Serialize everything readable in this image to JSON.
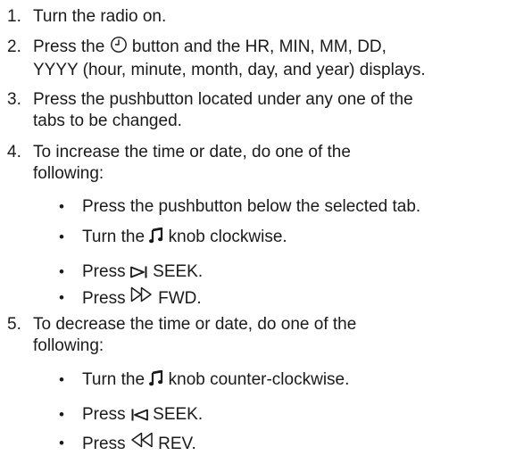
{
  "steps": [
    {
      "n": "1.",
      "lines": [
        "Turn the radio on."
      ]
    },
    {
      "n": "2.",
      "l1a": "Press the",
      "l1b": "button and the HR, MIN, MM, DD,",
      "l2": "YYYY (hour, minute, month, day, and year) displays.",
      "icon": "clock-icon"
    },
    {
      "n": "3.",
      "lines": [
        "Press the pushbutton located under any one of the",
        "tabs to be changed."
      ]
    },
    {
      "n": "4.",
      "lines": [
        "To increase the time or date, do one of the",
        "following:"
      ],
      "bullets": [
        {
          "text": "Press the pushbutton below the selected tab."
        },
        {
          "pre": "Turn the",
          "post": "knob clockwise.",
          "icon": "music-note-icon"
        },
        {
          "pre": "Press",
          "post": "SEEK.",
          "icon": "seek-forward-icon"
        },
        {
          "pre": "Press",
          "post": "FWD.",
          "icon": "fast-forward-icon"
        }
      ]
    },
    {
      "n": "5.",
      "lines": [
        "To decrease the time or date, do one of the",
        "following:"
      ],
      "bullets": [
        {
          "pre": "Turn the",
          "post": "knob counter-clockwise.",
          "icon": "music-note-icon"
        },
        {
          "pre": "Press",
          "post": "SEEK.",
          "icon": "seek-backward-icon"
        },
        {
          "pre": "Press",
          "post": "REV.",
          "icon": "rewind-icon"
        }
      ]
    }
  ],
  "bullet_char": "•"
}
